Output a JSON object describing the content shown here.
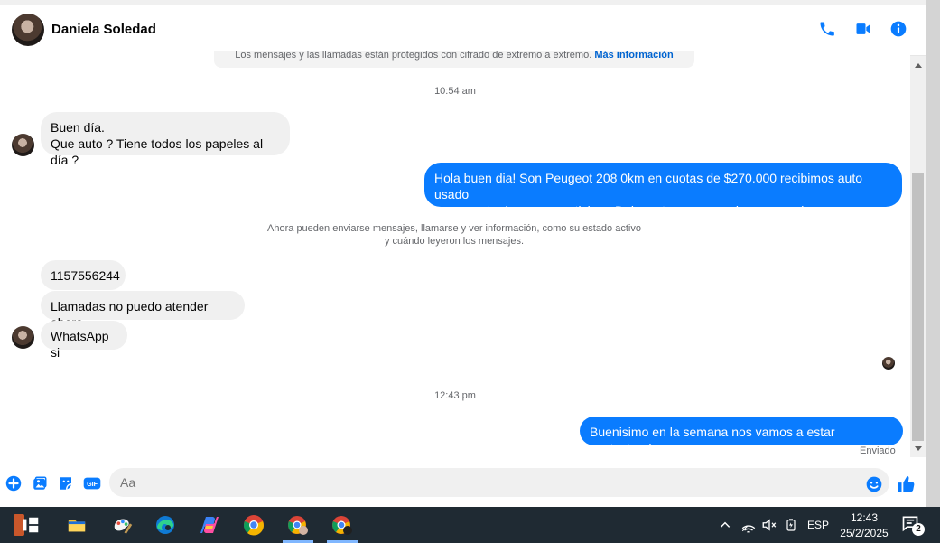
{
  "conversation": {
    "contact_name": "Daniela Soledad",
    "encryption_notice_text": "Los mensajes y las llamadas están protegidos con cifrado de extremo a extremo.",
    "encryption_notice_link": "Más información",
    "messages": {
      "time_first": "10:54 am",
      "incoming_1_line_1": "Buen día.",
      "incoming_1_line_2": "Que auto ? Tiene todos los papeles al día ?",
      "outgoing_1_line_1": "Hola buen dia! Son Peugeot 208 0km en cuotas de $270.000 recibimos auto usado",
      "outgoing_1_line_2": "como parte de pago o anticipo . Dejame tu numero asi me comunico con vos",
      "contact_notice_line_1": "Ahora pueden enviarse mensajes, llamarse y ver información, como su estado activo",
      "contact_notice_line_2": "y cuándo leyeron los mensajes.",
      "incoming_2": "1157556244",
      "incoming_3": "Llamadas no puedo atender ahora",
      "incoming_4": "WhatsApp si",
      "time_second": "12:43 pm",
      "outgoing_2": "Buenisimo en la semana nos vamos a estar contactando.",
      "status": "Enviado"
    },
    "composer_placeholder": "Aa"
  },
  "taskbar": {
    "language": "ESP",
    "time": "12:43",
    "date": "25/2/2025",
    "notification_count": "2"
  },
  "colors": {
    "accent": "#0a7cff",
    "incoming_bubble": "#f0f0f0",
    "taskbar": "#1f2a33"
  }
}
